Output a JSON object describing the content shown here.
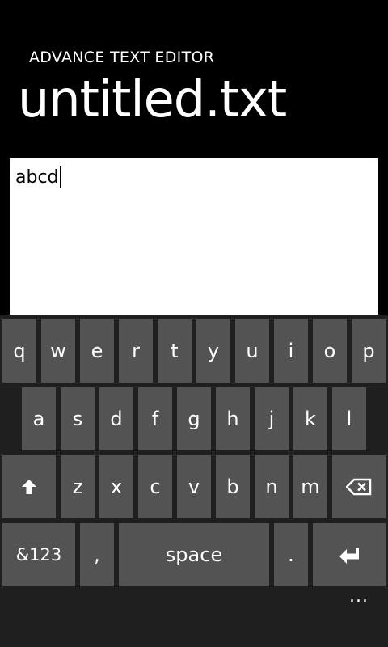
{
  "app": {
    "title": "ADVANCE TEXT EDITOR",
    "file_name": "untitled.txt"
  },
  "editor": {
    "content": "abcd"
  },
  "keyboard": {
    "row1": [
      "q",
      "w",
      "e",
      "r",
      "t",
      "y",
      "u",
      "i",
      "o",
      "p"
    ],
    "row2": [
      "a",
      "s",
      "d",
      "f",
      "g",
      "h",
      "j",
      "k",
      "l"
    ],
    "row3": [
      "z",
      "x",
      "c",
      "v",
      "b",
      "n",
      "m"
    ],
    "shift_icon": "shift-arrow-icon",
    "backspace_icon": "backspace-icon",
    "symbols_label": "&123",
    "comma_label": ",",
    "space_label": "space",
    "period_label": ".",
    "enter_icon": "enter-icon"
  },
  "app_bar": {
    "more_label": "..."
  },
  "colors": {
    "background": "#000000",
    "editor_background": "#ffffff",
    "key_background": "#535353",
    "keyboard_background": "#1f1f1f"
  }
}
